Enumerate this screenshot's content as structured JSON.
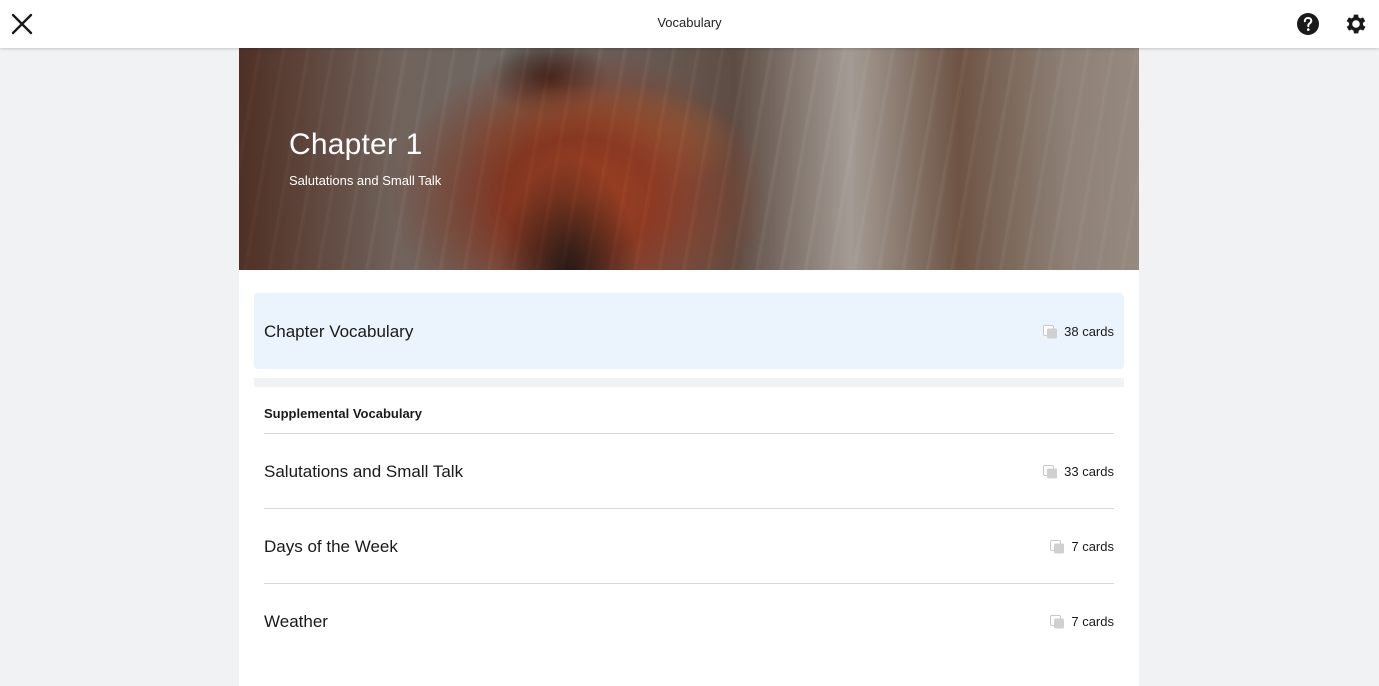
{
  "header": {
    "title": "Vocabulary",
    "close_icon": "close-icon",
    "help_icon": "help-icon",
    "settings_icon": "gear-icon"
  },
  "hero": {
    "title": "Chapter 1",
    "subtitle": "Salutations and Small Talk"
  },
  "chapter_vocabulary": {
    "label": "Chapter Vocabulary",
    "count": "38 cards"
  },
  "supplemental": {
    "heading": "Supplemental Vocabulary",
    "items": [
      {
        "label": "Salutations and Small Talk",
        "count": "33 cards"
      },
      {
        "label": "Days of the Week",
        "count": "7 cards"
      },
      {
        "label": "Weather",
        "count": "7 cards"
      }
    ]
  },
  "colors": {
    "background": "#f0f2f4",
    "highlight_row": "#ebf3fc",
    "text": "#1a1a1a"
  }
}
